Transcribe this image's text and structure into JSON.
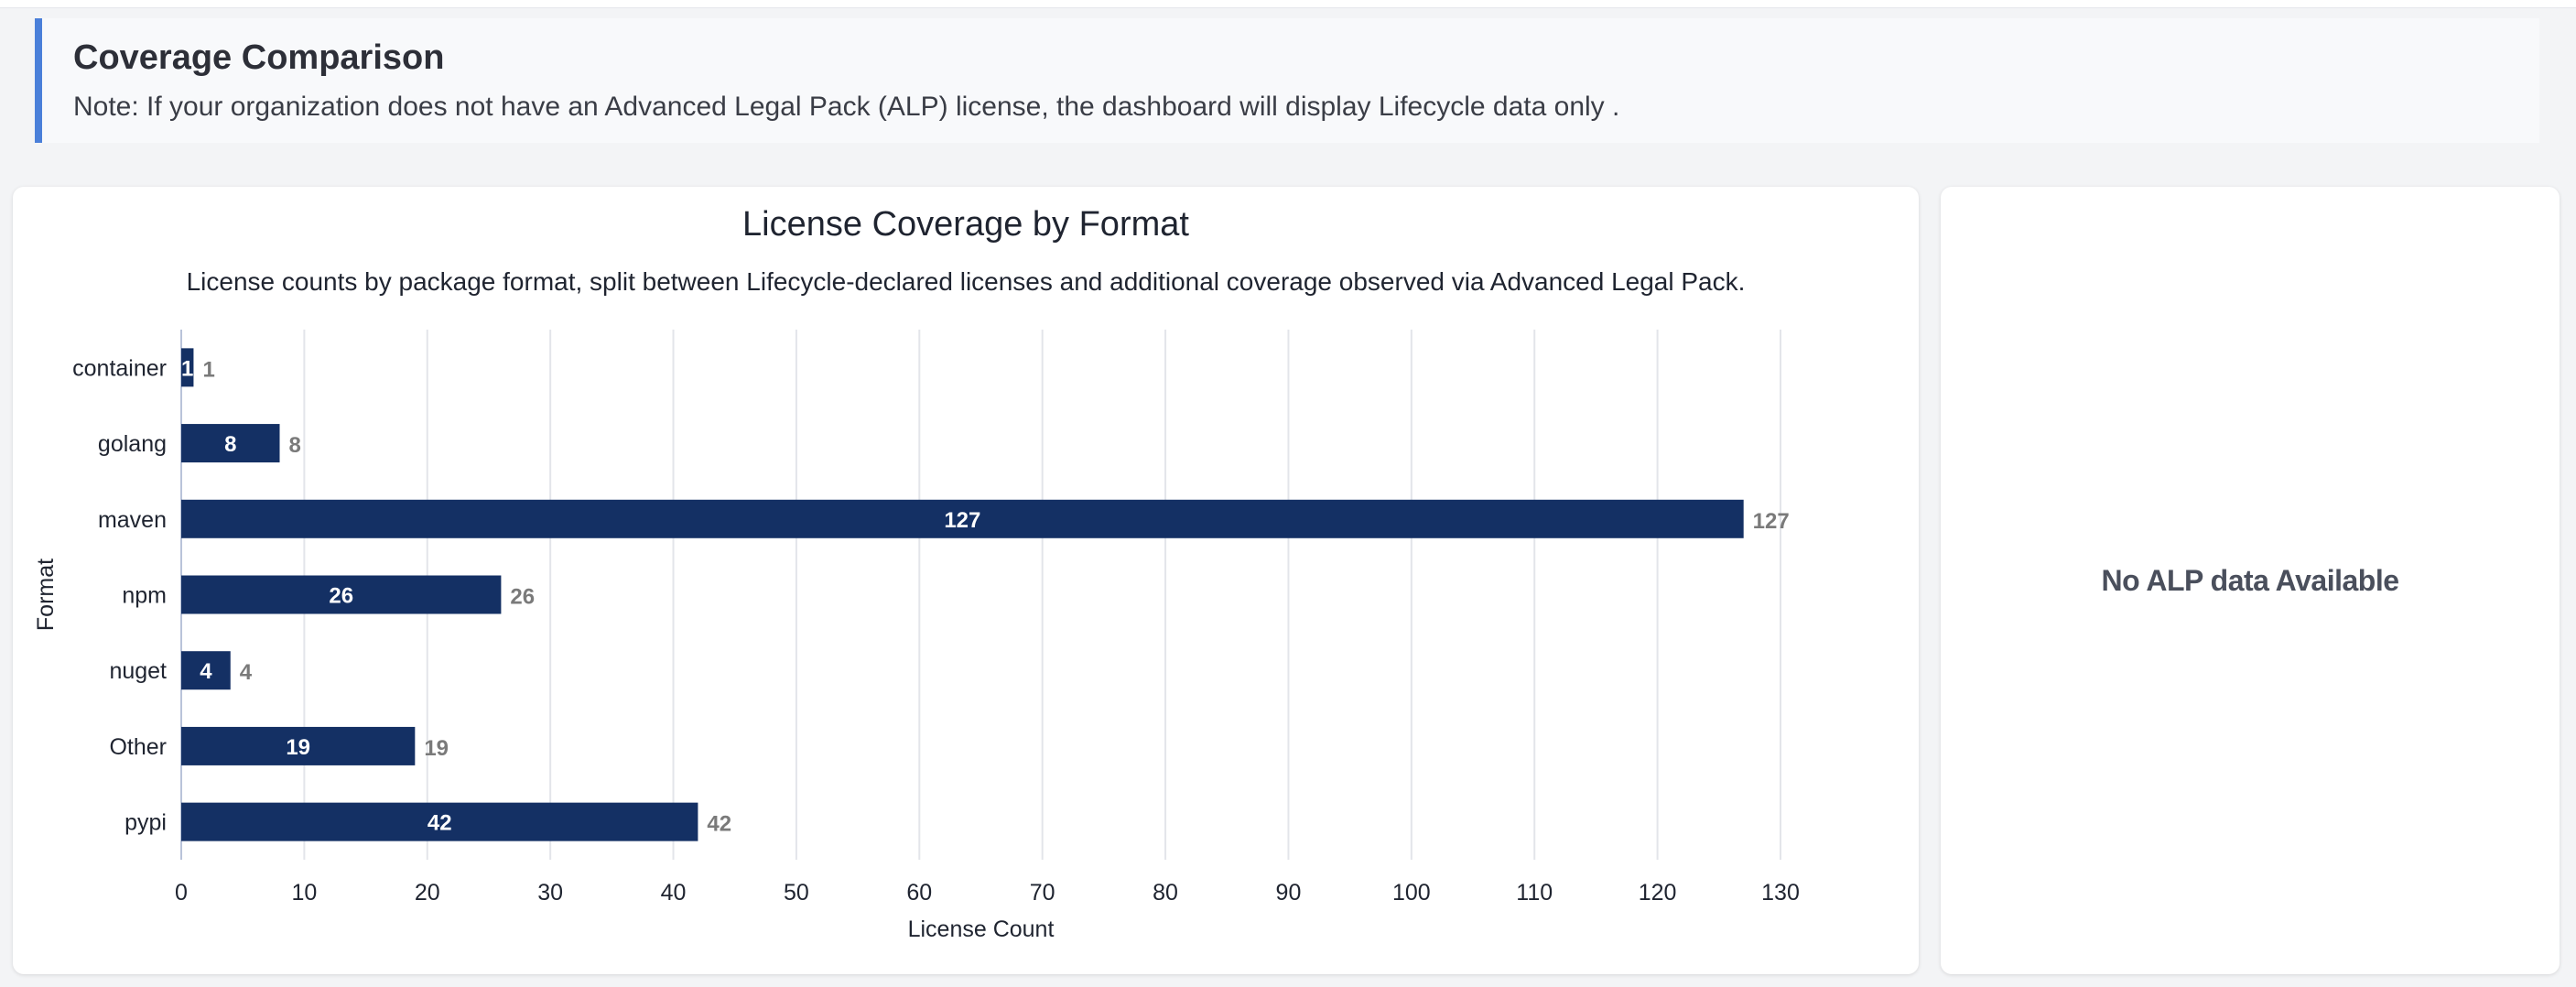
{
  "note": {
    "title": "Coverage Comparison",
    "text": "Note: If your organization does not have an Advanced Legal Pack (ALP) license, the dashboard will display Lifecycle data only ."
  },
  "alp": {
    "message": "No ALP data Available"
  },
  "colors": {
    "accent": "#4a7fd9",
    "bar": "#143064",
    "bar_label": "#ffffff",
    "end_label": "#7a7a7a",
    "grid": "#e3e5ea"
  },
  "chart_data": {
    "type": "bar",
    "orientation": "horizontal",
    "title": "License Coverage by Format",
    "subtitle": "License counts by package format, split between Lifecycle-declared licenses and additional coverage observed via Advanced Legal Pack.",
    "xlabel": "License Count",
    "ylabel": "Format",
    "categories": [
      "container",
      "golang",
      "maven",
      "npm",
      "nuget",
      "Other",
      "pypi"
    ],
    "values": [
      1,
      8,
      127,
      26,
      4,
      19,
      42
    ],
    "xlim": [
      0,
      130
    ],
    "xticks": [
      0,
      10,
      20,
      30,
      40,
      50,
      60,
      70,
      80,
      90,
      100,
      110,
      120,
      130
    ],
    "grid": true
  }
}
